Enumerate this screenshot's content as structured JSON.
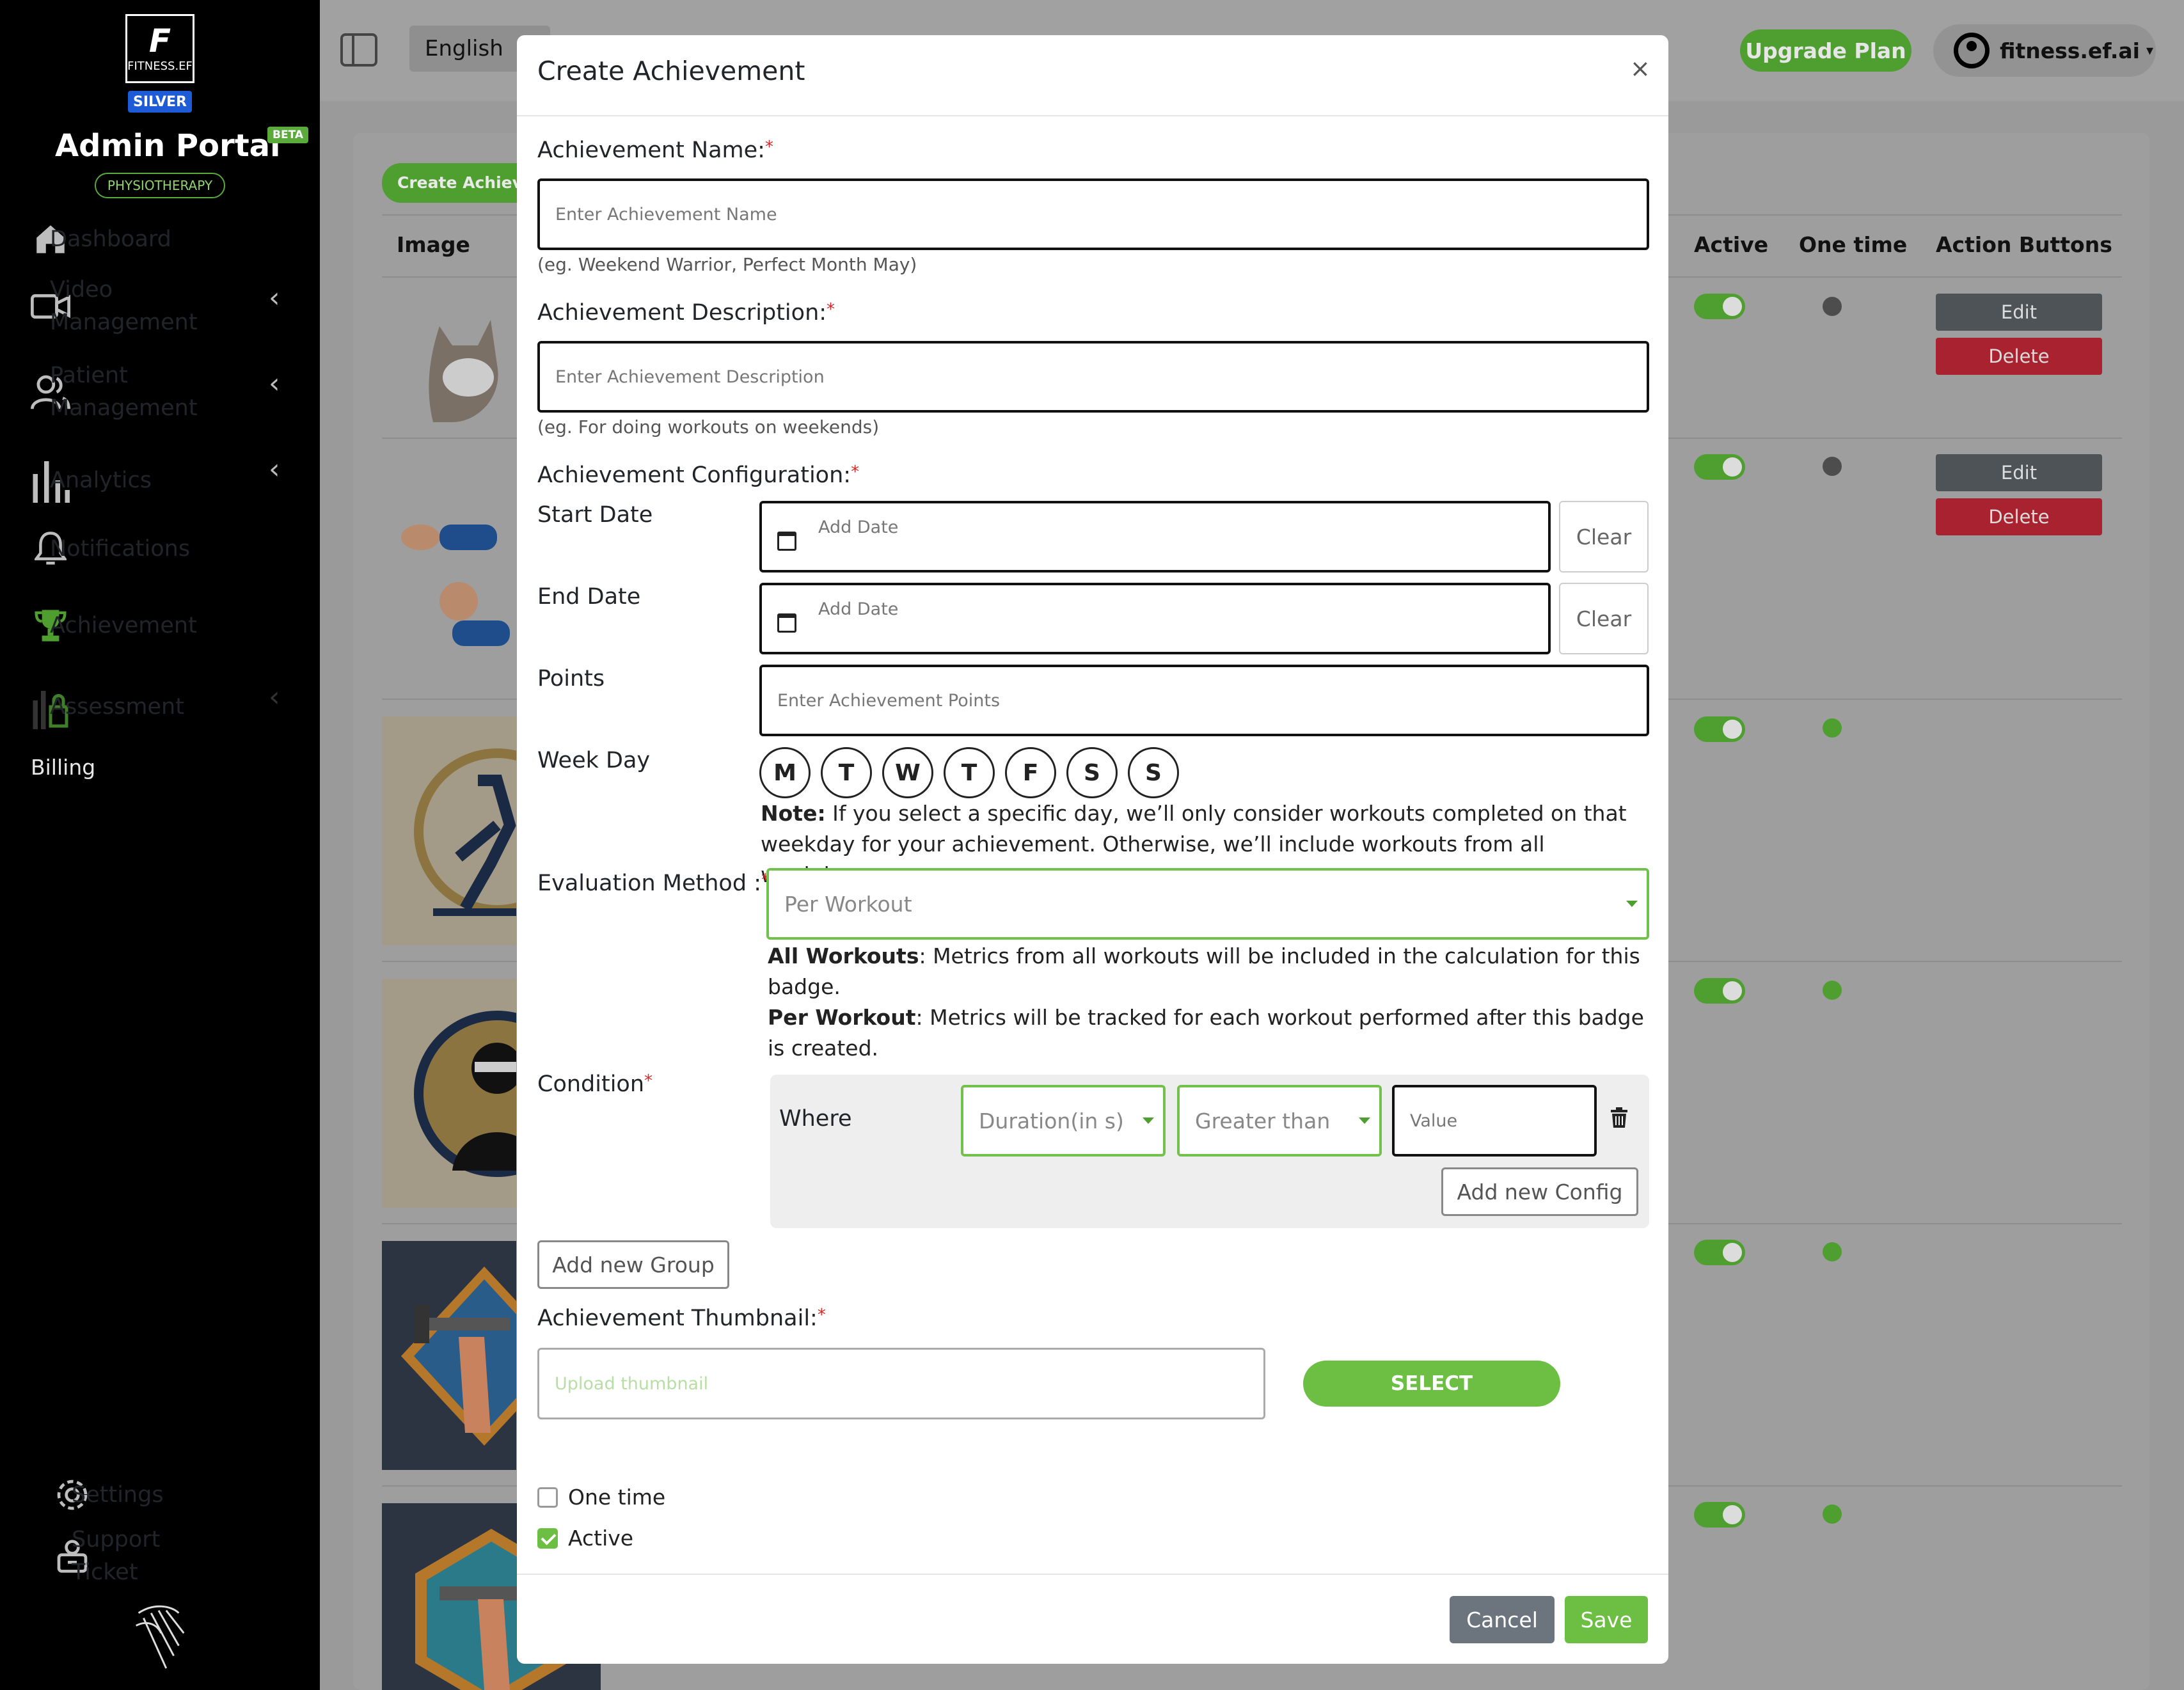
{
  "sidebar": {
    "logo_letter": "F",
    "logo_text": "FITNESS.EF",
    "tier": "SILVER",
    "title": "Admin Portal",
    "beta": "BETA",
    "specialty": "PHYSIOTHERAPY",
    "items": [
      {
        "label": "Dashboard",
        "icon": "home-icon"
      },
      {
        "label": "Video Management",
        "icon": "video-camera-icon"
      },
      {
        "label": "Patient Management",
        "icon": "users-icon"
      },
      {
        "label": "Analytics",
        "icon": "bar-chart-icon"
      },
      {
        "label": "Notifications",
        "icon": "bell-icon"
      },
      {
        "label": "Achievement",
        "icon": "trophy-icon"
      },
      {
        "label": "Assessment",
        "icon": "lock-icon"
      }
    ],
    "billing": "Billing",
    "settings": "Settings",
    "support": "Support Ticket"
  },
  "topbar": {
    "language": "English",
    "upgrade": "Upgrade Plan",
    "account": "fitness.ef.ai"
  },
  "table": {
    "create_button": "Create Achievement",
    "headers": {
      "image": "Image",
      "active": "Active",
      "one_time": "One time",
      "actions": "Action Buttons"
    },
    "edit": "Edit",
    "delete": "Delete",
    "rows": [
      {
        "active": true,
        "one_time": false
      },
      {
        "active": true,
        "one_time": false
      },
      {
        "active": true,
        "one_time": true
      },
      {
        "active": true,
        "one_time": true
      },
      {
        "active": true,
        "one_time": true
      },
      {
        "active": true,
        "one_time": true
      }
    ]
  },
  "modal": {
    "title": "Create Achievement",
    "close": "×",
    "name_label": "Achievement Name:",
    "name_placeholder": "Enter Achievement Name",
    "name_hint": "(eg. Weekend Warrior, Perfect Month May)",
    "desc_label": "Achievement Description:",
    "desc_placeholder": "Enter Achievement Description",
    "desc_hint": "(eg. For doing workouts on weekends)",
    "config_label": "Achievement Configuration:",
    "start_label": "Start Date",
    "end_label": "End Date",
    "date_placeholder": "Add Date",
    "clear": "Clear",
    "points_label": "Points",
    "points_placeholder": "Enter Achievement Points",
    "weekday_label": "Week Day",
    "weekdays": [
      "M",
      "T",
      "W",
      "T",
      "F",
      "S",
      "S"
    ],
    "note_bold": "Note:",
    "note_text": " If you select a specific day, we’ll only consider workouts completed on that weekday for your achievement. Otherwise, we’ll include workouts from all weekdays.",
    "eval_label": "Evaluation Method :",
    "eval_value": "Per Workout",
    "all_bold": "All Workouts",
    "all_text": ": Metrics from all workouts will be included in the calculation for this badge.",
    "per_bold": "Per Workout",
    "per_text": ": Metrics will be tracked for each workout performed after this badge is created.",
    "condition_label": "Condition",
    "where": "Where",
    "metric": "Duration(in s)",
    "operator": "Greater than",
    "value_placeholder": "Value",
    "add_config": "Add new Config",
    "add_group": "Add new Group",
    "thumb_label": "Achievement Thumbnail:",
    "thumb_placeholder": "Upload thumbnail",
    "select": "SELECT",
    "one_time": "One time",
    "active": "Active",
    "cancel": "Cancel",
    "save": "Save"
  },
  "colors": {
    "accent": "#6cbf43",
    "danger": "#a8232f",
    "required": "#d62828"
  }
}
